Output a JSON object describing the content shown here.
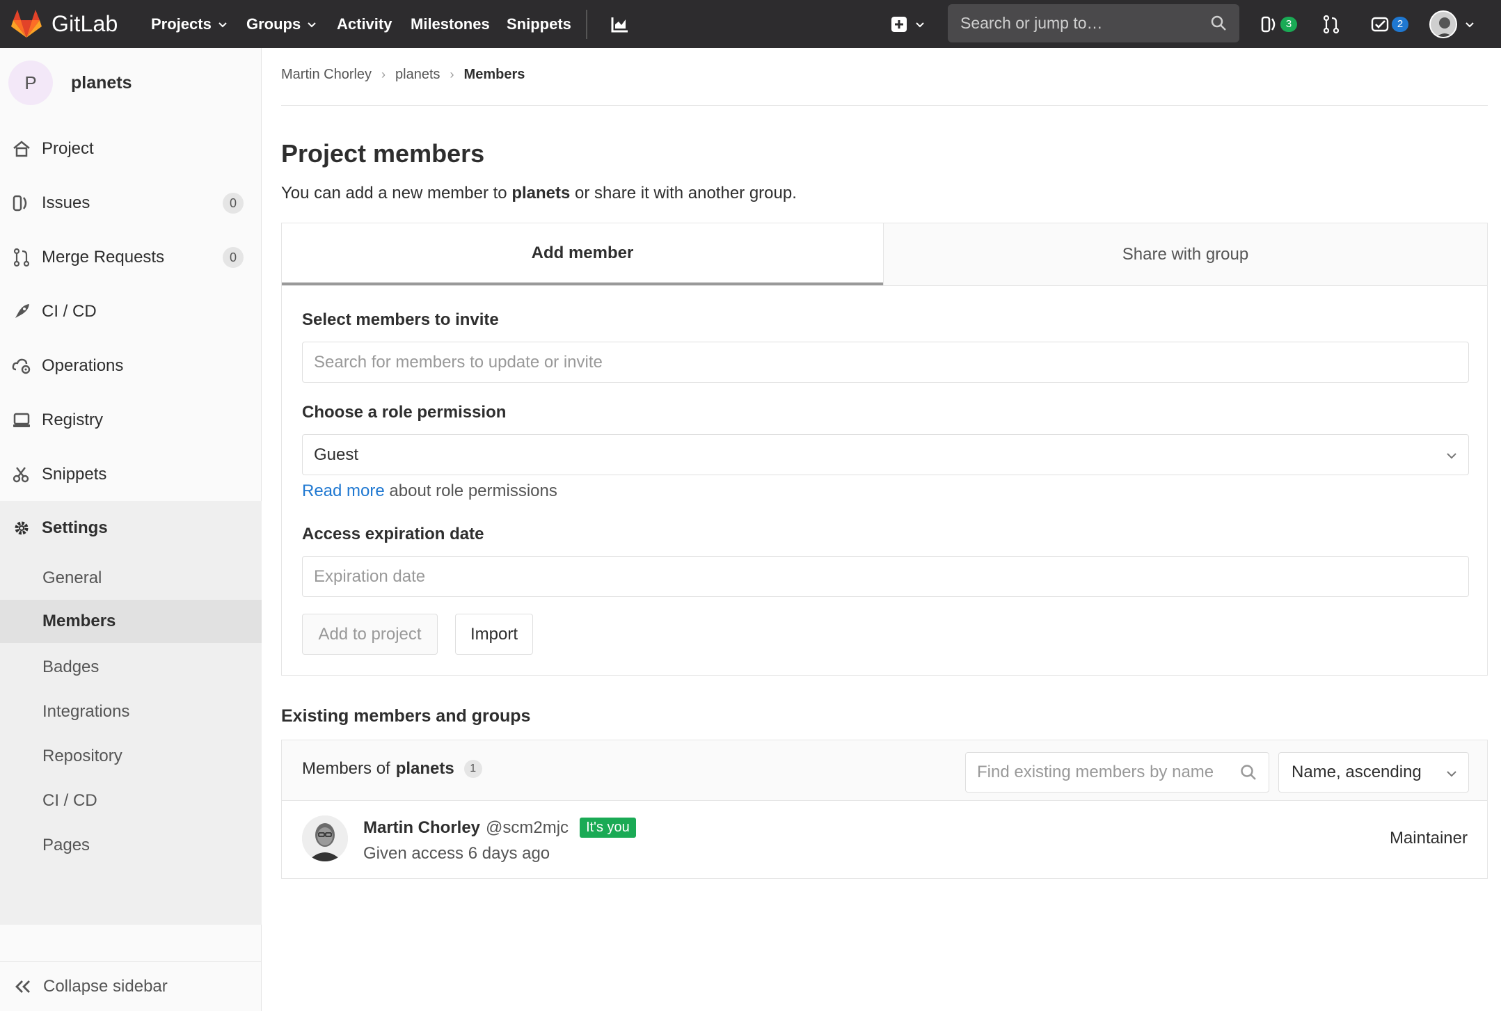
{
  "navbar": {
    "brand": "GitLab",
    "projects": "Projects",
    "groups": "Groups",
    "activity": "Activity",
    "milestones": "Milestones",
    "snippets": "Snippets",
    "search_placeholder": "Search or jump to…",
    "issues_count": "3",
    "todos_count": "2"
  },
  "sidebar": {
    "project_initial": "P",
    "project_name": "planets",
    "items": [
      {
        "label": "Project"
      },
      {
        "label": "Issues",
        "count": "0"
      },
      {
        "label": "Merge Requests",
        "count": "0"
      },
      {
        "label": "CI / CD"
      },
      {
        "label": "Operations"
      },
      {
        "label": "Registry"
      },
      {
        "label": "Snippets"
      },
      {
        "label": "Settings"
      }
    ],
    "settings_sub": [
      "General",
      "Members",
      "Badges",
      "Integrations",
      "Repository",
      "CI / CD",
      "Pages"
    ],
    "collapse_label": "Collapse sidebar"
  },
  "breadcrumb": {
    "user": "Martin Chorley",
    "project": "planets",
    "current": "Members"
  },
  "page": {
    "title": "Project members",
    "desc_prefix": "You can add a new member to ",
    "desc_project": "planets",
    "desc_suffix": " or share it with another group."
  },
  "tabs": {
    "add_member": "Add member",
    "share_group": "Share with group"
  },
  "form": {
    "select_label": "Select members to invite",
    "select_placeholder": "Search for members to update or invite",
    "role_label": "Choose a role permission",
    "role_value": "Guest",
    "read_more": "Read more",
    "read_more_suffix": " about role permissions",
    "expiration_label": "Access expiration date",
    "expiration_placeholder": "Expiration date",
    "add_button": "Add to project",
    "import_button": "Import"
  },
  "existing": {
    "title": "Existing members and groups",
    "members_of": "Members of ",
    "project": "planets",
    "count": "1",
    "find_placeholder": "Find existing members by name",
    "sort_value": "Name, ascending"
  },
  "member": {
    "name": "Martin Chorley",
    "username": "@scm2mjc",
    "badge": "It's you",
    "access": "Given access 6 days ago",
    "role": "Maintainer"
  }
}
